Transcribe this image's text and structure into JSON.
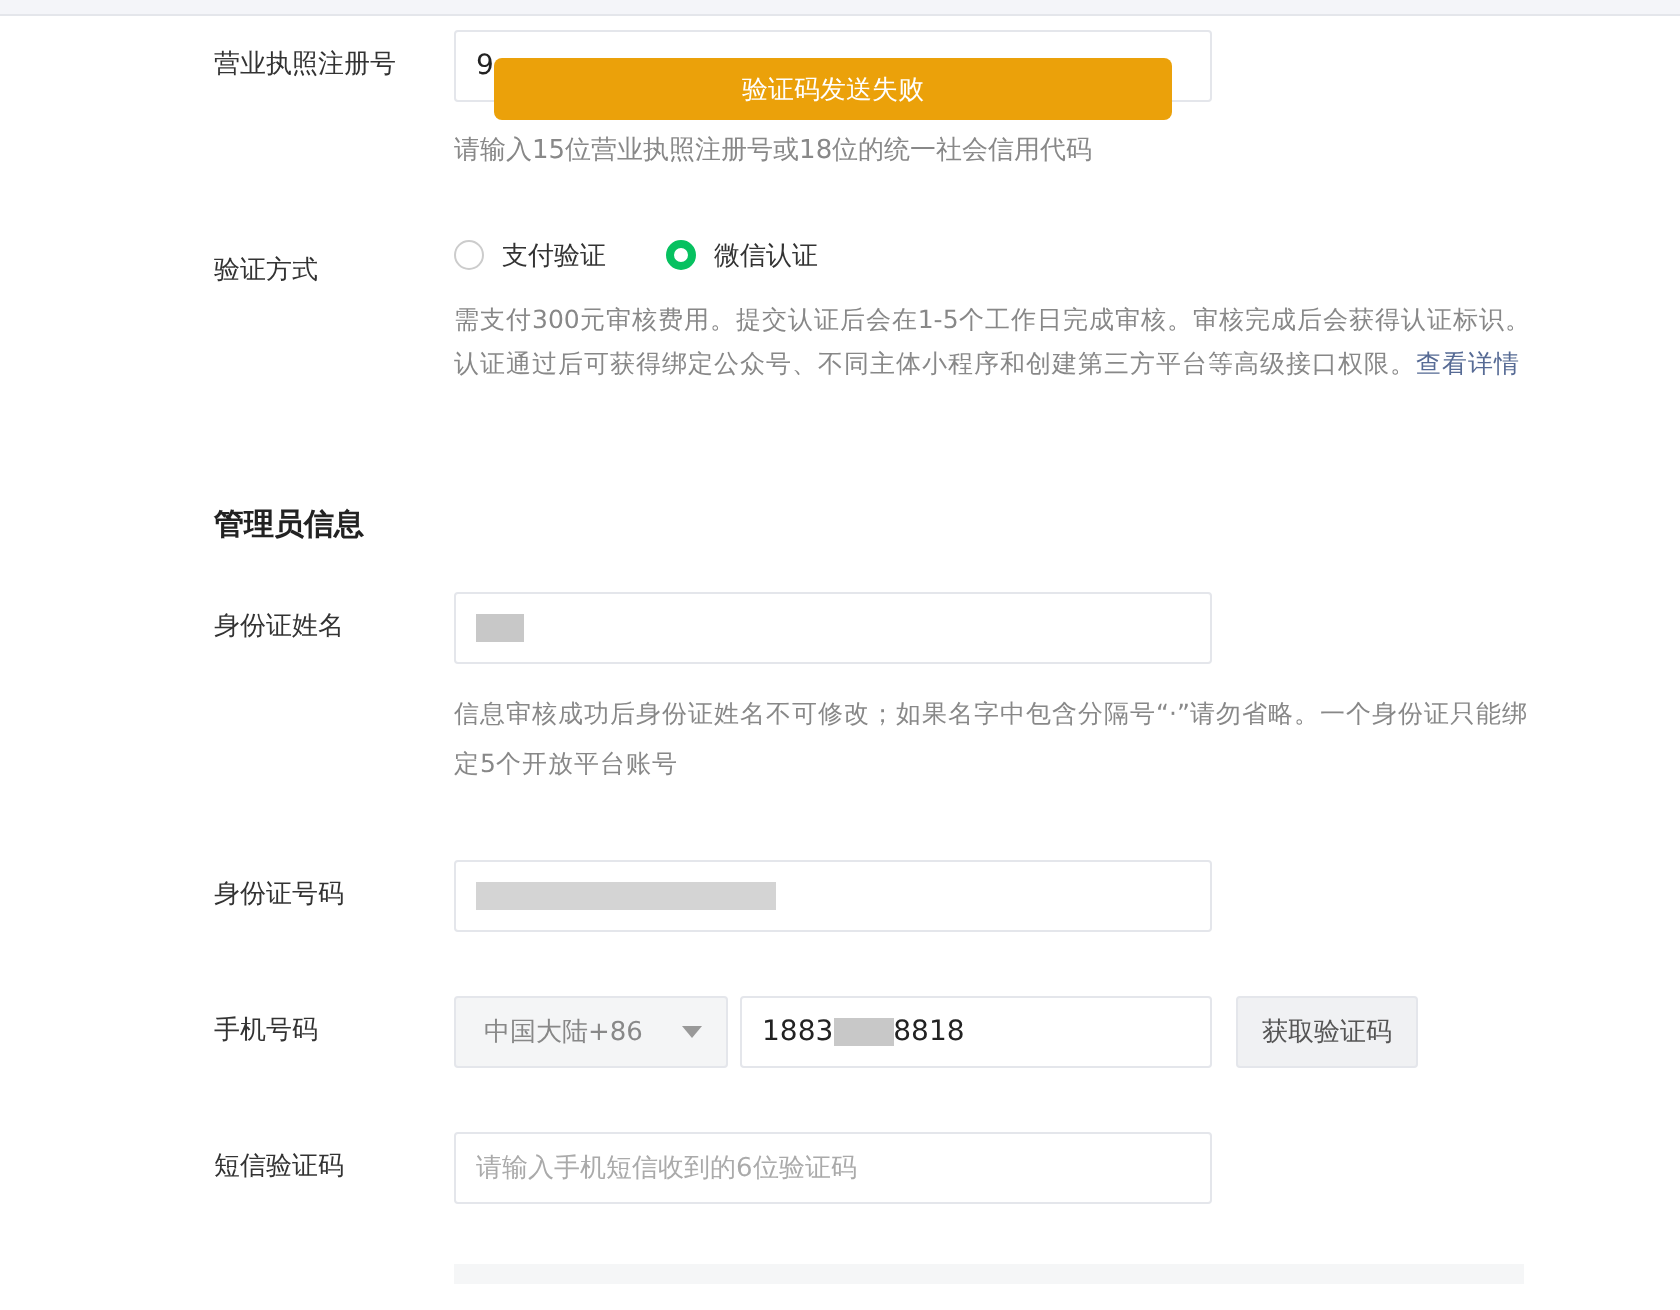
{
  "toast": {
    "text": "验证码发送失败"
  },
  "license": {
    "label": "营业执照注册号",
    "value": "9",
    "hint": "请输入15位营业执照注册号或18位的统一社会信用代码"
  },
  "verify": {
    "label": "验证方式",
    "options": [
      {
        "label": "支付验证",
        "selected": false
      },
      {
        "label": "微信认证",
        "selected": true
      }
    ],
    "description": "需支付300元审核费用。提交认证后会在1-5个工作日完成审核。审核完成后会获得认证标识。认证通过后可获得绑定公众号、不同主体小程序和创建第三方平台等高级接口权限。",
    "link": "查看详情"
  },
  "section_title": "管理员信息",
  "name": {
    "label": "身份证姓名",
    "hint": "信息审核成功后身份证姓名不可修改；如果名字中包含分隔号“·”请勿省略。一个身份证只能绑定5个开放平台账号"
  },
  "id_number": {
    "label": "身份证号码"
  },
  "phone": {
    "label": "手机号码",
    "region": "中国大陆+86",
    "value_start": "1883",
    "value_end": "8818",
    "button": "获取验证码"
  },
  "sms": {
    "label": "短信验证码",
    "placeholder": "请输入手机短信收到的6位验证码"
  }
}
